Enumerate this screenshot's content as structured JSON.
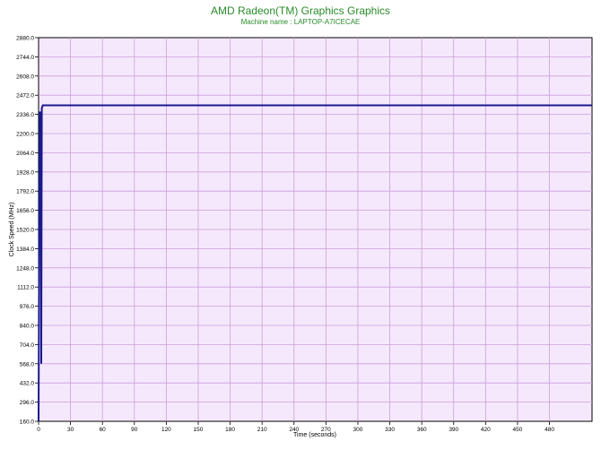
{
  "chart_data": {
    "type": "line",
    "title": "AMD Radeon(TM) Graphics Graphics",
    "subtitle": "Machine name : LAPTOP-A7ICECAE",
    "xlabel": "Time (seconds)",
    "ylabel": "Clock Speed (MHz)",
    "xlim": [
      0,
      520
    ],
    "ylim": [
      160,
      2880
    ],
    "x_ticks": [
      0,
      30,
      60,
      90,
      120,
      150,
      180,
      210,
      240,
      270,
      300,
      330,
      360,
      390,
      420,
      450,
      480
    ],
    "y_ticks": [
      "160.0",
      "296.0",
      "432.0",
      "568.0",
      "704.0",
      "840.0",
      "976.0",
      "1112.0",
      "1248.0",
      "1384.0",
      "1520.0",
      "1656.0",
      "1792.0",
      "1928.0",
      "2064.0",
      "2200.0",
      "2336.0",
      "2472.0",
      "2608.0",
      "2744.0",
      "2880.0"
    ],
    "grid": true,
    "colors": {
      "plot_bg": "#f5e8fc",
      "grid": "#c9a0dc",
      "line": "#1a1a8c",
      "title": "#2a8a2a"
    },
    "series": [
      {
        "values_xy": [
          [
            0,
            160
          ],
          [
            1,
            2350
          ],
          [
            2,
            2350
          ],
          [
            2.5,
            568
          ],
          [
            3,
            2380
          ],
          [
            4,
            2400
          ],
          [
            520,
            2400
          ]
        ]
      }
    ]
  }
}
